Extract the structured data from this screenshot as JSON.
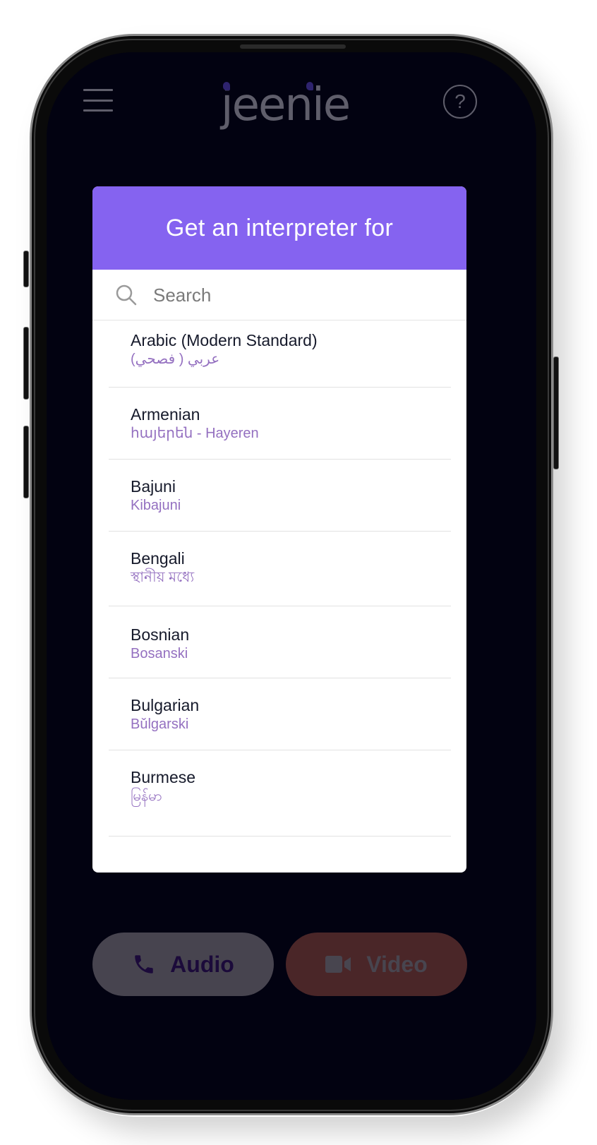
{
  "header": {
    "logo_text": "jeenie",
    "menu_icon": "hamburger-menu-icon",
    "help_icon": "question-circle-icon",
    "help_glyph": "?"
  },
  "modal": {
    "title": "Get an interpreter for",
    "search": {
      "placeholder": "Search",
      "value": "",
      "icon": "search-icon"
    },
    "languages": [
      {
        "name": "Arabic (Modern Standard)",
        "native": "عربي ( فصحي)"
      },
      {
        "name": "Armenian",
        "native": "հայերեն - Hayeren"
      },
      {
        "name": "Bajuni",
        "native": "Kibajuni"
      },
      {
        "name": "Bengali",
        "native": "স্থানীয় মধ্যে"
      },
      {
        "name": "Bosnian",
        "native": "Bosanski"
      },
      {
        "name": "Bulgarian",
        "native": "Bǔlgarski"
      },
      {
        "name": "Burmese",
        "native": "မြန်မာ"
      }
    ]
  },
  "actions": {
    "audio_label": "Audio",
    "audio_icon": "phone-icon",
    "video_label": "Video",
    "video_icon": "video-camera-icon"
  },
  "colors": {
    "accent": "#8563f0",
    "screen_bg": "#020211",
    "native_text": "#9470c0",
    "audio_button": "#47444f",
    "video_button": "#4a2628"
  }
}
